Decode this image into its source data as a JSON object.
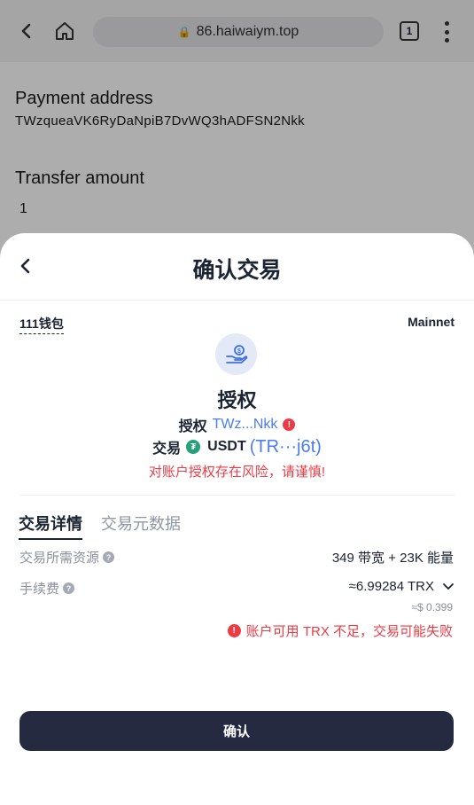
{
  "browser": {
    "url": "86.haiwaiym.top",
    "tab_count": "1"
  },
  "background_page": {
    "payment_label": "Payment address",
    "payment_value": "TWzqueaVK6RyDaNpiB7DvWQ3hADFSN2Nkk",
    "amount_label": "Transfer amount",
    "amount_value": "1"
  },
  "sheet": {
    "title": "确认交易",
    "wallet_name": "111钱包",
    "network": "Mainnet",
    "action_title": "授权",
    "auth_label": "授权",
    "auth_address": "TWz...Nkk",
    "tx_label": "交易",
    "token": "USDT",
    "token_address": "(TR···j6t)",
    "risk_warning": "对账户授权存在风险，请谨慎!",
    "tabs": [
      {
        "label": "交易详情"
      },
      {
        "label": "交易元数据"
      }
    ],
    "resources_label": "交易所需资源",
    "resources_value": "349 带宽 + 23K 能量",
    "fee_label": "手续费",
    "fee_value": "≈6.99284 TRX",
    "fee_usd": "≈$ 0.399",
    "insufficient_warning": "账户可用 TRX 不足，交易可能失败",
    "confirm_label": "确认"
  },
  "colors": {
    "accent_blue": "#4a7cf0",
    "danger_red": "#ec3b45",
    "button_dark": "#252a40",
    "tether_green": "#26a17b"
  }
}
